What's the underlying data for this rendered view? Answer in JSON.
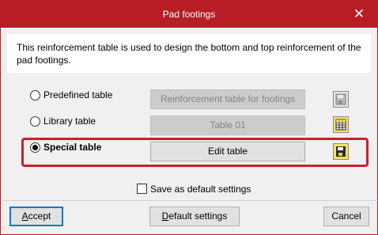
{
  "window": {
    "title": "Pad footings",
    "close_glyph": "✕"
  },
  "description": "This reinforcement table is used to design the bottom and top reinforcement of the pad footings.",
  "options": [
    {
      "label": "Predefined table",
      "selected": false,
      "button": "Reinforcement table for footings",
      "button_enabled": false,
      "icon": "save-disk-icon"
    },
    {
      "label": "Library table",
      "selected": false,
      "button": "Table 01",
      "button_enabled": false,
      "icon": "table-grid-icon"
    },
    {
      "label": "Special table",
      "selected": true,
      "button": "Edit table",
      "button_enabled": true,
      "icon": "save-disk-icon"
    }
  ],
  "save_default": {
    "label": "Save as default settings",
    "checked": false
  },
  "footer": {
    "accept_prefix": "",
    "accept_mnemonic": "A",
    "accept_rest": "ccept",
    "default_prefix": "",
    "default_mnemonic": "D",
    "default_rest": "efault settings",
    "cancel": "Cancel"
  },
  "colors": {
    "titlebar": "#b81c25",
    "highlight": "#cc1f2b",
    "icon_yellow": "#e8d22a",
    "icon_dark": "#2b2b2b"
  }
}
